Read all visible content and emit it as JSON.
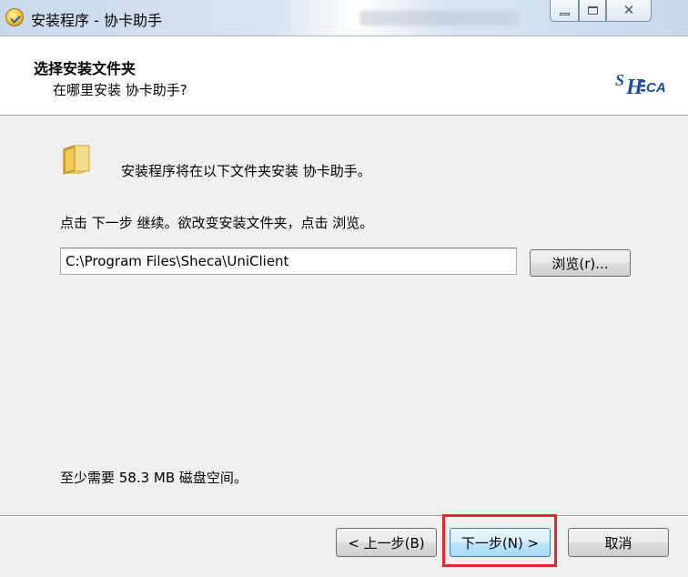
{
  "window": {
    "title": "安装程序 - 协卡助手",
    "icons": {
      "app": "setup-app-icon",
      "minimize": "minimize-icon",
      "maximize": "maximize-icon",
      "close": "close-icon"
    },
    "close_glyph": "✕"
  },
  "header": {
    "title": "选择安装文件夹",
    "subtitle": "在哪里安装 协卡助手?",
    "logo_text": "SHECA"
  },
  "body": {
    "intro": "安装程序将在以下文件夹安装 协卡助手。",
    "instruction": "点击 下一步 继续。欲改变安装文件夹，点击 浏览。",
    "path_value": "C:\\Program Files\\Sheca\\UniClient",
    "browse_label": "浏览(r)...",
    "space_required": "至少需要 58.3 MB 磁盘空间。",
    "folder_icon": "folder-icon"
  },
  "footer": {
    "back_label": "< 上一步(B)",
    "next_label": "下一步(N) >",
    "cancel_label": "取消",
    "highlight_color": "#e8262b"
  }
}
